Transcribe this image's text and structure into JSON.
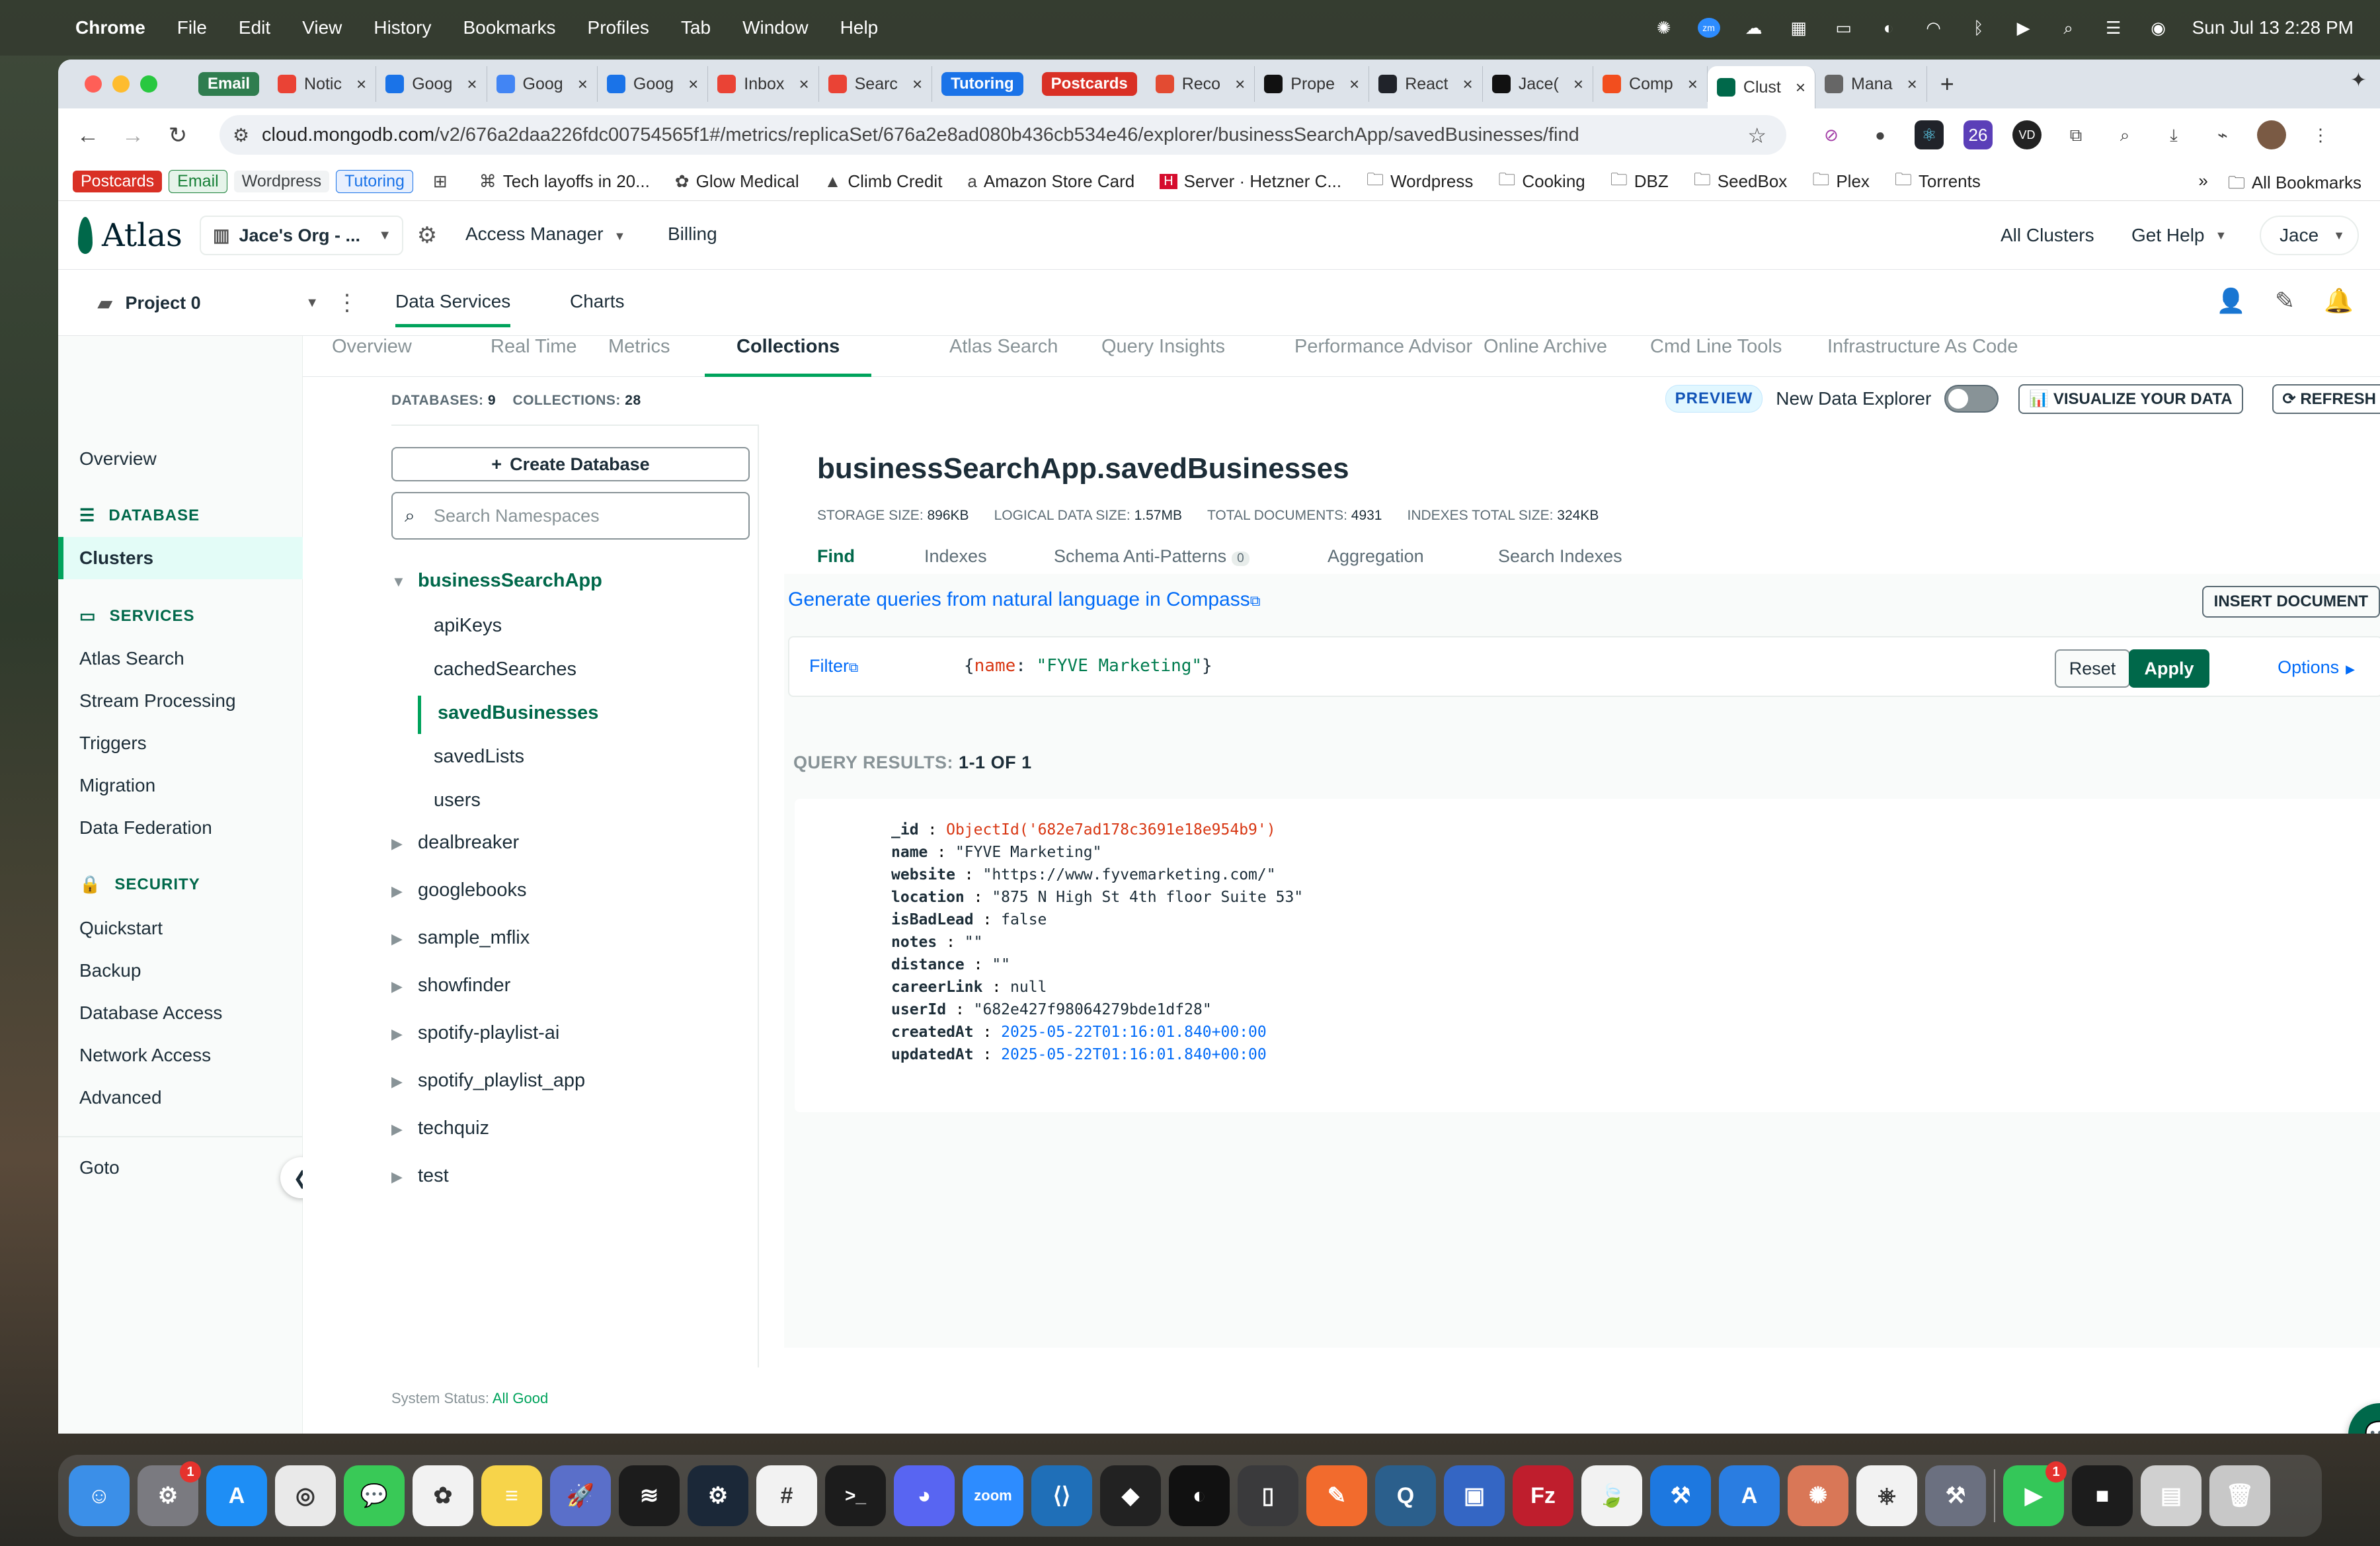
{
  "menubar": {
    "app": "Chrome",
    "items": [
      "File",
      "Edit",
      "View",
      "History",
      "Bookmarks",
      "Profiles",
      "Tab",
      "Window",
      "Help"
    ],
    "datetime": "Sun Jul 13  2:28 PM"
  },
  "tabs": [
    {
      "label": "Email",
      "pill": true,
      "color": "#2f7d4f"
    },
    {
      "label": "Notic",
      "icon": "gmail-icon"
    },
    {
      "label": "Goog",
      "icon": "drive-icon"
    },
    {
      "label": "Goog",
      "icon": "google-icon"
    },
    {
      "label": "Goog",
      "icon": "drive-icon"
    },
    {
      "label": "Inbox",
      "icon": "gmail-icon"
    },
    {
      "label": "Searc",
      "icon": "gmail-icon"
    },
    {
      "label": "Tutoring",
      "pill": true,
      "color": "#1a73e8"
    },
    {
      "label": "Postcards",
      "pill": true,
      "color": "#d93025"
    },
    {
      "label": "Reco",
      "icon": "pdf-icon"
    },
    {
      "label": "Prope",
      "icon": "js-icon"
    },
    {
      "label": "React",
      "icon": "react-icon"
    },
    {
      "label": "Jace(",
      "icon": "github-icon"
    },
    {
      "label": "Comp",
      "icon": "figma-icon"
    },
    {
      "label": "Clust",
      "icon": "mongodb-icon",
      "active": true
    },
    {
      "label": "Mana",
      "icon": "settings-icon"
    }
  ],
  "address": {
    "domain": "cloud.mongodb.com",
    "path": "/v2/676a2daa226fdc00754565f1#/metrics/replicaSet/676a2e8ad080b436cb534e46/explorer/businessSearchApp/savedBusinesses/find"
  },
  "bookmarks": {
    "items": [
      {
        "label": "Postcards",
        "style": "pill-red"
      },
      {
        "label": "Email",
        "style": "pill-green"
      },
      {
        "label": "Wordpress",
        "style": "pill-gray"
      },
      {
        "label": "Tutoring",
        "style": "pill-blue"
      },
      {
        "label": "",
        "icon": "apps-grid-icon"
      },
      {
        "label": "Tech layoffs in 20...",
        "icon": "tech-icon"
      },
      {
        "label": "Glow Medical",
        "icon": "glow-icon"
      },
      {
        "label": "Climb Credit",
        "icon": "climb-icon"
      },
      {
        "label": "Amazon Store Card",
        "icon": "amazon-icon"
      },
      {
        "label": "Server · Hetzner C...",
        "icon": "hetzner-icon"
      },
      {
        "label": "Wordpress",
        "icon": "folder-icon"
      },
      {
        "label": "Cooking",
        "icon": "folder-icon"
      },
      {
        "label": "DBZ",
        "icon": "folder-icon"
      },
      {
        "label": "SeedBox",
        "icon": "folder-icon"
      },
      {
        "label": "Plex",
        "icon": "folder-icon"
      },
      {
        "label": "Torrents",
        "icon": "folder-icon"
      }
    ],
    "more": "»",
    "all": "All Bookmarks"
  },
  "atlas": {
    "logo": "Atlas",
    "org": "Jace's Org - ...",
    "access_manager": "Access Manager",
    "billing": "Billing",
    "all_clusters": "All Clusters",
    "get_help": "Get Help",
    "user": "Jace"
  },
  "project": {
    "name": "Project 0",
    "tabs": [
      "Data Services",
      "Charts"
    ]
  },
  "sidebar": {
    "overview": "Overview",
    "database_header": "DATABASE",
    "clusters": "Clusters",
    "services_header": "SERVICES",
    "services": [
      "Atlas Search",
      "Stream Processing",
      "Triggers",
      "Migration",
      "Data Federation"
    ],
    "security_header": "SECURITY",
    "security": [
      "Quickstart",
      "Backup",
      "Database Access",
      "Network Access",
      "Advanced"
    ],
    "goto": "Goto"
  },
  "cluster_tabs": [
    "Overview",
    "Real Time",
    "Metrics",
    "Collections",
    "Atlas Search",
    "Query Insights",
    "Performance Advisor",
    "Online Archive",
    "Cmd Line Tools",
    "Infrastructure As Code"
  ],
  "counts": {
    "databases_label": "DATABASES:",
    "databases": "9",
    "collections_label": "COLLECTIONS:",
    "collections": "28"
  },
  "preview": {
    "badge": "PREVIEW",
    "label": "New Data Explorer",
    "visualize": "VISUALIZE YOUR DATA",
    "refresh": "REFRESH"
  },
  "namespaces": {
    "create_db": "Create Database",
    "search_placeholder": "Search Namespaces",
    "open_db": "businessSearchApp",
    "collections": [
      "apiKeys",
      "cachedSearches",
      "savedBusinesses",
      "savedLists",
      "users"
    ],
    "selected_collection": "savedBusinesses",
    "other_dbs": [
      "dealbreaker",
      "googlebooks",
      "sample_mflix",
      "showfinder",
      "spotify-playlist-ai",
      "spotify_playlist_app",
      "techquiz",
      "test"
    ]
  },
  "collection": {
    "title": "businessSearchApp.savedBusinesses",
    "stats": [
      {
        "k": "STORAGE SIZE:",
        "v": "896KB"
      },
      {
        "k": "LOGICAL DATA SIZE:",
        "v": "1.57MB"
      },
      {
        "k": "TOTAL DOCUMENTS:",
        "v": "4931"
      },
      {
        "k": "INDEXES TOTAL SIZE:",
        "v": "324KB"
      }
    ],
    "tabs": {
      "find": "Find",
      "indexes": "Indexes",
      "schema": "Schema Anti-Patterns",
      "schema_count": "0",
      "aggregation": "Aggregation",
      "search_indexes": "Search Indexes"
    },
    "compass_link": "Generate queries from natural language in Compass",
    "insert": "INSERT DOCUMENT",
    "filter_label": "Filter",
    "filter": {
      "open": "{",
      "key": "name",
      "colon": ": ",
      "value": "\"FYVE Marketing\"",
      "close": "}"
    },
    "reset": "Reset",
    "apply": "Apply",
    "options": "Options",
    "results_label": "QUERY RESULTS:",
    "results_count": "1-1 OF 1",
    "document": [
      {
        "k": "_id",
        "v": "ObjectId('682e7ad178c3691e18e954b9')",
        "type": "oid"
      },
      {
        "k": "name",
        "v": "\"FYVE Marketing\"",
        "type": "str"
      },
      {
        "k": "website",
        "v": "\"https://www.fyvemarketing.com/\"",
        "type": "str"
      },
      {
        "k": "location",
        "v": "\"875 N High St 4th floor Suite 53\"",
        "type": "str"
      },
      {
        "k": "isBadLead",
        "v": "false",
        "type": "str"
      },
      {
        "k": "notes",
        "v": "\"\"",
        "type": "str"
      },
      {
        "k": "distance",
        "v": "\"\"",
        "type": "str"
      },
      {
        "k": "careerLink",
        "v": "null",
        "type": "str"
      },
      {
        "k": "userId",
        "v": "\"682e427f98064279bde1df28\"",
        "type": "str"
      },
      {
        "k": "createdAt",
        "v": "2025-05-22T01:16:01.840+00:00",
        "type": "date"
      },
      {
        "k": "updatedAt",
        "v": "2025-05-22T01:16:01.840+00:00",
        "type": "date"
      }
    ]
  },
  "status": {
    "label": "System Status:",
    "value": "All Good"
  },
  "dock": [
    {
      "name": "finder-icon",
      "color": "#3b8fe8"
    },
    {
      "name": "system-settings-icon",
      "color": "#7a7a80",
      "badge": "1"
    },
    {
      "name": "app-store-icon",
      "color": "#1e8ef5"
    },
    {
      "name": "chrome-icon",
      "color": "#e9e9e9"
    },
    {
      "name": "messages-icon",
      "color": "#39c957"
    },
    {
      "name": "photos-icon",
      "color": "#f2f2f2"
    },
    {
      "name": "notes-icon",
      "color": "#f7d44a"
    },
    {
      "name": "rocket-icon",
      "color": "#5a6fc9"
    },
    {
      "name": "spotify-icon",
      "color": "#1c1c1c"
    },
    {
      "name": "steam-icon",
      "color": "#1b2838"
    },
    {
      "name": "slack-icon",
      "color": "#f2f2f2"
    },
    {
      "name": "terminal-icon",
      "color": "#1c1c1c"
    },
    {
      "name": "discord-icon",
      "color": "#5865f2"
    },
    {
      "name": "zoom-icon",
      "color": "#2d8cff"
    },
    {
      "name": "vscode-icon",
      "color": "#1f6fb8"
    },
    {
      "name": "unity-icon",
      "color": "#222"
    },
    {
      "name": "darkroom-icon",
      "color": "#111"
    },
    {
      "name": "simulator-icon",
      "color": "#3a3a3c"
    },
    {
      "name": "sketch-pen-icon",
      "color": "#f26b2d"
    },
    {
      "name": "quicktime-icon",
      "color": "#2b5f8c"
    },
    {
      "name": "preview-icon",
      "color": "#3466c4"
    },
    {
      "name": "filezilla-icon",
      "color": "#bf1e2d"
    },
    {
      "name": "mongodb-compass-icon",
      "color": "#f2f2f2"
    },
    {
      "name": "xcode-icon",
      "color": "#1d78e0"
    },
    {
      "name": "instruments-icon",
      "color": "#2a7de1"
    },
    {
      "name": "claude-icon",
      "color": "#d97757"
    },
    {
      "name": "chatgpt-icon",
      "color": "#f2f2f2"
    },
    {
      "name": "utility-icon",
      "color": "#6b7080"
    },
    {
      "name": "facetime-icon",
      "color": "#34c759",
      "badge": "1"
    },
    {
      "name": "stickies-icon",
      "color": "#1c1c1c"
    },
    {
      "name": "documents-icon",
      "color": "#d0d0d0"
    },
    {
      "name": "trash-icon",
      "color": "#c8c8c8"
    }
  ]
}
